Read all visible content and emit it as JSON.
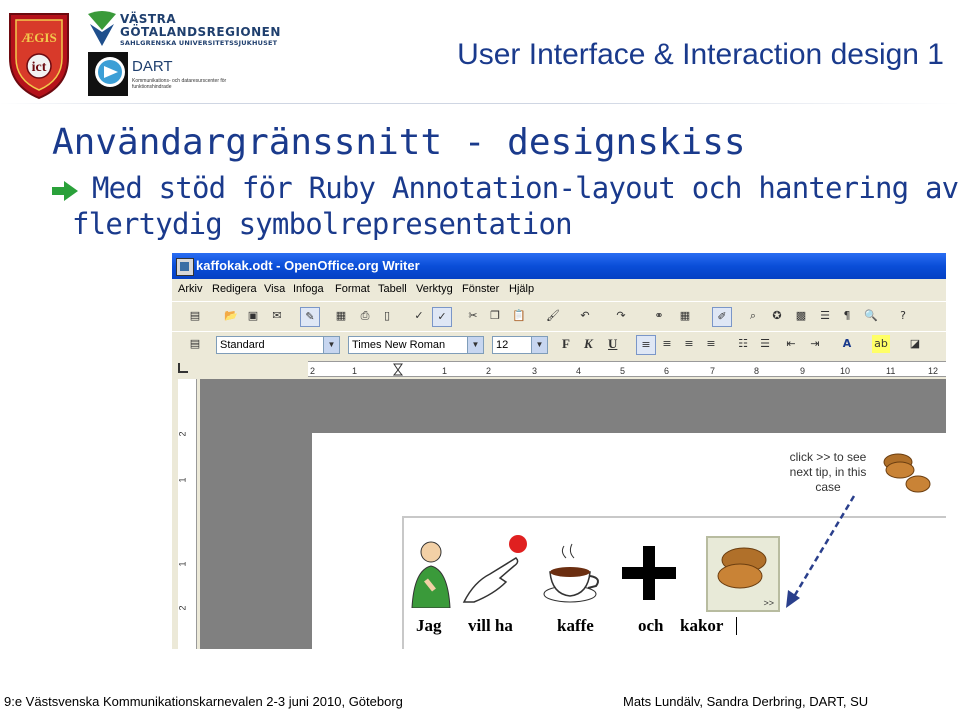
{
  "header": {
    "title": "User Interface & Interaction design 1",
    "logo_aegis": "ÆGIS",
    "logo_vgr_line1": "VÄSTRA",
    "logo_vgr_line2": "GÖTALANDSREGIONEN",
    "logo_vgr_line3": "SAHLGRENSKA UNIVERSITETSSJUKHUSET",
    "logo_dart_name": "DART",
    "logo_dart_sub": "Kommunikations- och dataresurscenter för funktionshindrade"
  },
  "slide": {
    "title": "Användargränssnitt - designskiss",
    "bullet_line1": "Med stöd för Ruby Annotation-layout och hantering av",
    "bullet_line2": "flertydig symbolrepresentation"
  },
  "screenshot": {
    "window_title": "kaffokak.odt - OpenOffice.org Writer",
    "menu": [
      "Arkiv",
      "Redigera",
      "Visa",
      "Infoga",
      "Format",
      "Tabell",
      "Verktyg",
      "Fönster",
      "Hjälp"
    ],
    "style_value": "Standard",
    "font_value": "Times New Roman",
    "size_value": "12",
    "format_buttons": [
      "F",
      "K",
      "U"
    ],
    "ruler_numbers": [
      "2",
      "1",
      "1",
      "2",
      "3",
      "4",
      "5",
      "6",
      "7",
      "8",
      "9",
      "10",
      "11",
      "12"
    ],
    "vruler_numbers": [
      "2",
      "1",
      "1",
      "2"
    ],
    "tip": "click >> to see next tip, in this case",
    "tip_button": ">>",
    "symbol_labels": [
      "Jag",
      "vill ha",
      "kaffe",
      "och",
      "kakor"
    ]
  },
  "footer": {
    "left": "9:e Västsvenska Kommunikationskarnevalen 2-3 juni 2010, Göteborg",
    "right": "Mats Lundälv, Sandra Derbring, DART, SU"
  },
  "colors": {
    "title_blue": "#1a3a8c",
    "arrow_green": "#2aa13a",
    "xp_titlebar": "#0a4ed8"
  }
}
